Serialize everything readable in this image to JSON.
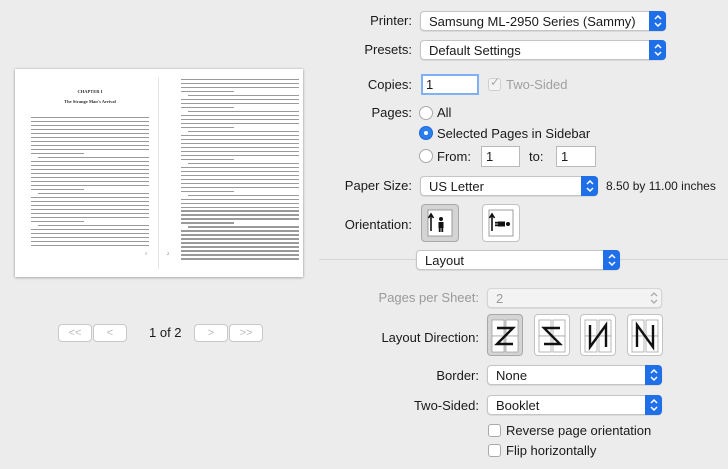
{
  "preview": {
    "chapter_heading": "CHAPTER I",
    "chapter_title": "The Strange Man's Arrival",
    "page_number": "1 of 2"
  },
  "printer": {
    "label": "Printer:",
    "value": "Samsung ML-2950 Series (Sammy)"
  },
  "presets": {
    "label": "Presets:",
    "value": "Default Settings"
  },
  "copies": {
    "label": "Copies:",
    "value": "1",
    "two_sided_label": "Two-Sided"
  },
  "pages": {
    "label": "Pages:",
    "all_label": "All",
    "selected_label": "Selected Pages in Sidebar",
    "from_label": "From:",
    "from_value": "1",
    "to_label": "to:",
    "to_value": "1",
    "selected_option": "Selected Pages in Sidebar"
  },
  "paper_size": {
    "label": "Paper Size:",
    "value": "US Letter",
    "dimensions": "8.50 by 11.00 inches"
  },
  "orientation": {
    "label": "Orientation:",
    "selected": "portrait"
  },
  "section": {
    "value": "Layout"
  },
  "pages_per_sheet": {
    "label": "Pages per Sheet:",
    "value": "2"
  },
  "layout_direction": {
    "label": "Layout Direction:",
    "selected_index": 0
  },
  "border": {
    "label": "Border:",
    "value": "None"
  },
  "two_sided": {
    "label": "Two-Sided:",
    "value": "Booklet"
  },
  "reverse": {
    "label": "Reverse page orientation",
    "checked": false
  },
  "flip": {
    "label": "Flip horizontally",
    "checked": false
  },
  "colors": {
    "accent": "#1e6fe8",
    "background": "#ececec"
  }
}
